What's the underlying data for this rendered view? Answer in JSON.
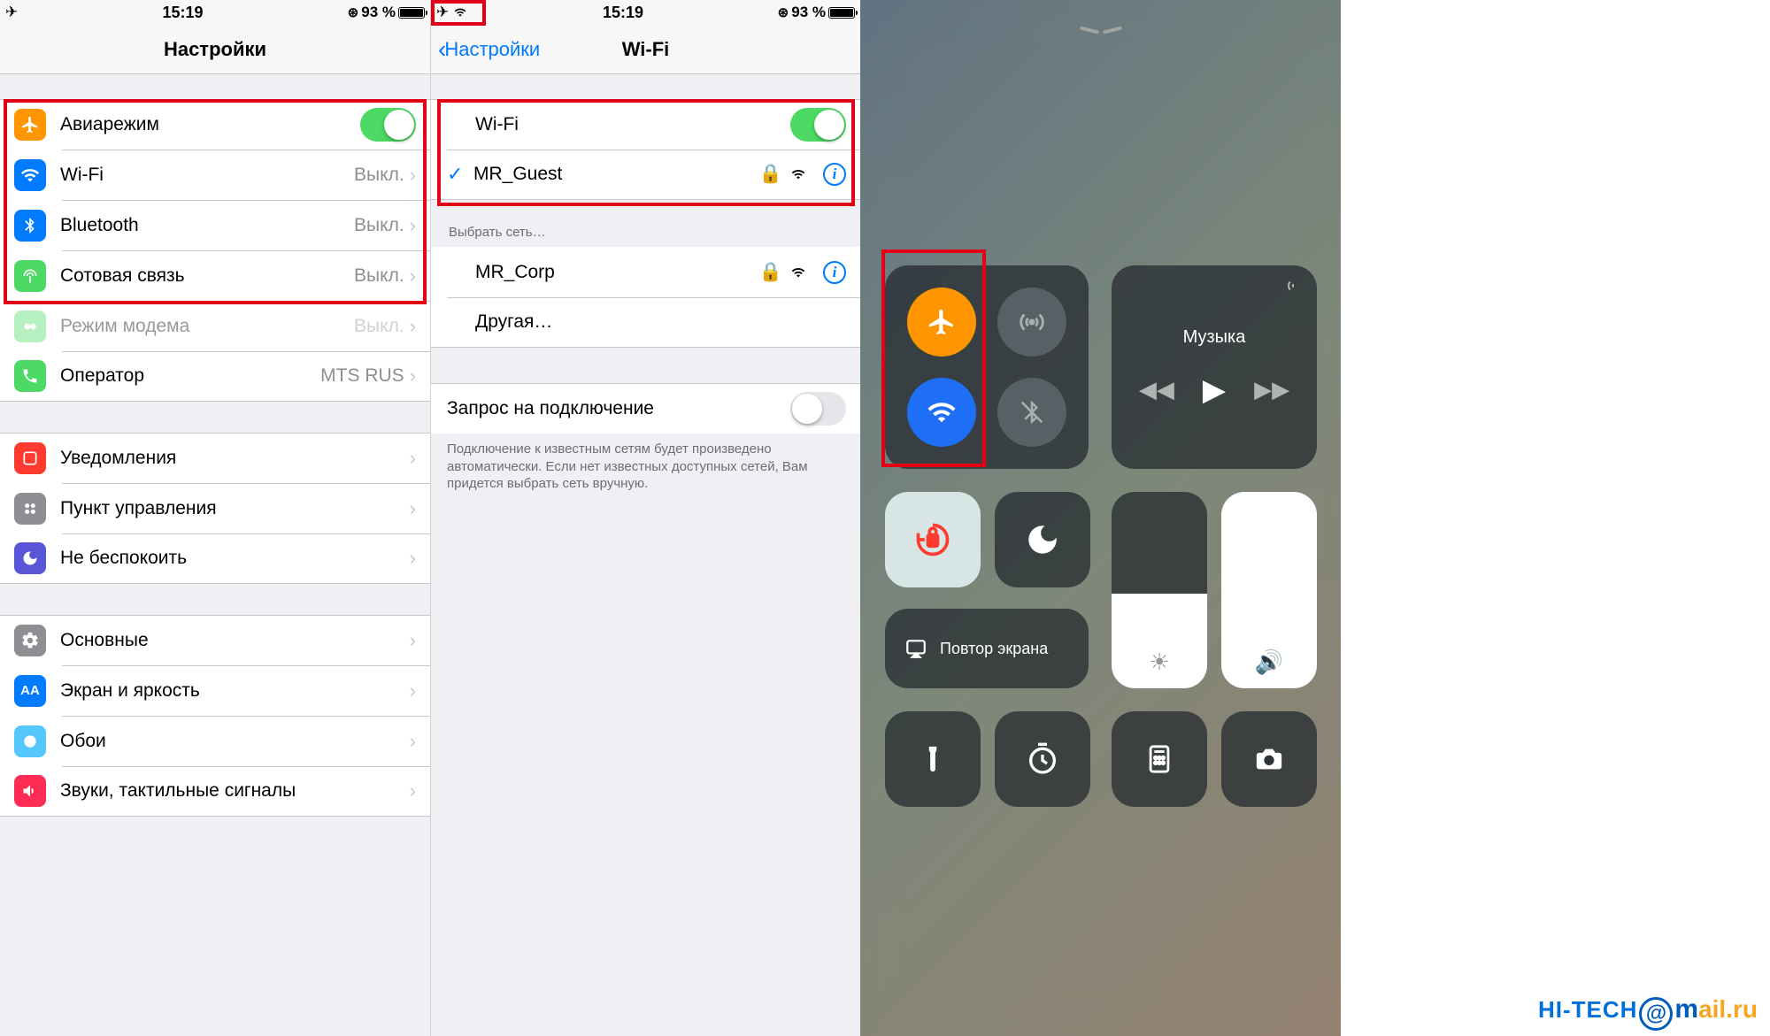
{
  "status": {
    "time": "15:19",
    "battery_pct": "93 %"
  },
  "screen1": {
    "title": "Настройки",
    "rows": {
      "airplane": {
        "label": "Авиарежим"
      },
      "wifi": {
        "label": "Wi-Fi",
        "detail": "Выкл."
      },
      "bluetooth": {
        "label": "Bluetooth",
        "detail": "Выкл."
      },
      "cellular": {
        "label": "Сотовая связь",
        "detail": "Выкл."
      },
      "hotspot": {
        "label": "Режим модема",
        "detail": "Выкл."
      },
      "carrier": {
        "label": "Оператор",
        "detail": "MTS RUS"
      },
      "notif": {
        "label": "Уведомления"
      },
      "cc": {
        "label": "Пункт управления"
      },
      "dnd": {
        "label": "Не беспокоить"
      },
      "general": {
        "label": "Основные"
      },
      "display": {
        "label": "Экран и яркость"
      },
      "wallpaper": {
        "label": "Обои"
      },
      "sounds": {
        "label": "Звуки, тактильные сигналы"
      }
    }
  },
  "screen2": {
    "back": "Настройки",
    "title": "Wi-Fi",
    "wifi_toggle_label": "Wi-Fi",
    "connected": "MR_Guest",
    "choose_header": "Выбрать сеть…",
    "networks": {
      "corp": "MR_Corp",
      "other": "Другая…"
    },
    "ask": {
      "label": "Запрос на подключение",
      "footer": "Подключение к известным сетям будет произведено автоматически. Если нет известных доступных сетей, Вам придется выбрать сеть вручную."
    }
  },
  "cc": {
    "music_label": "Музыка",
    "mirror_label": "Повтор экрана"
  },
  "watermark": {
    "left": "HI-TECH",
    "right": "ail.ru"
  }
}
